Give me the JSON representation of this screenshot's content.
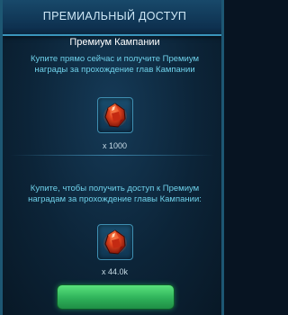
{
  "header": {
    "title": "ПРЕМИАЛЬНЫЙ ДОСТУП"
  },
  "subtitle": "Премиум Кампании",
  "offers": [
    {
      "description": "Купите прямо сейчас и получите Премиум награды за прохождение глав Кампании",
      "item_icon": "red-gem-icon",
      "quantity": "x 1000"
    },
    {
      "description": "Купите, чтобы получить доступ к Премиум наградам за прохождение главы Кампании:",
      "item_icon": "red-gem-icon",
      "quantity": "x 44.0k"
    }
  ],
  "buy_button": {
    "label": ""
  },
  "colors": {
    "accent": "#6fd1ea",
    "button": "#2fb25a",
    "gem": "#d3341a"
  }
}
